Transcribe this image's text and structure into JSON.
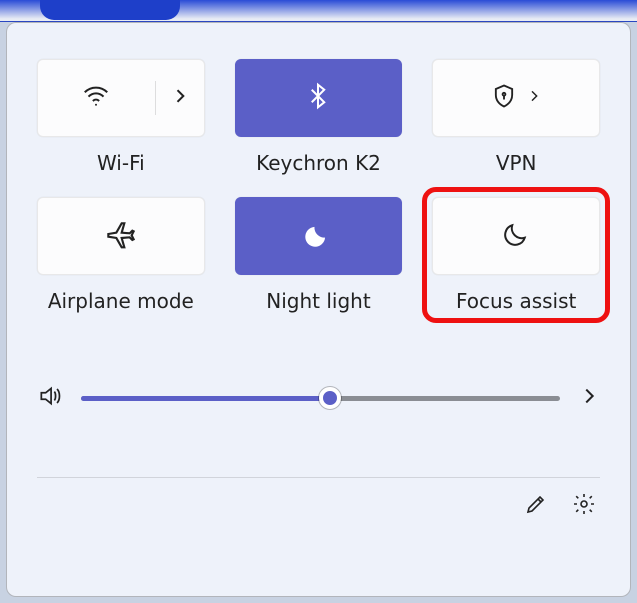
{
  "tiles": {
    "wifi": {
      "label": "Wi-Fi",
      "active": false
    },
    "bluetooth": {
      "label": "Keychron K2",
      "active": true
    },
    "vpn": {
      "label": "VPN",
      "active": false
    },
    "airplane": {
      "label": "Airplane mode",
      "active": false
    },
    "nightlight": {
      "label": "Night light",
      "active": true
    },
    "focusassist": {
      "label": "Focus assist",
      "active": false,
      "highlighted": true
    }
  },
  "volume": {
    "percent": 52
  },
  "colors": {
    "accent": "#5b5fc7",
    "highlight": "#e11"
  }
}
